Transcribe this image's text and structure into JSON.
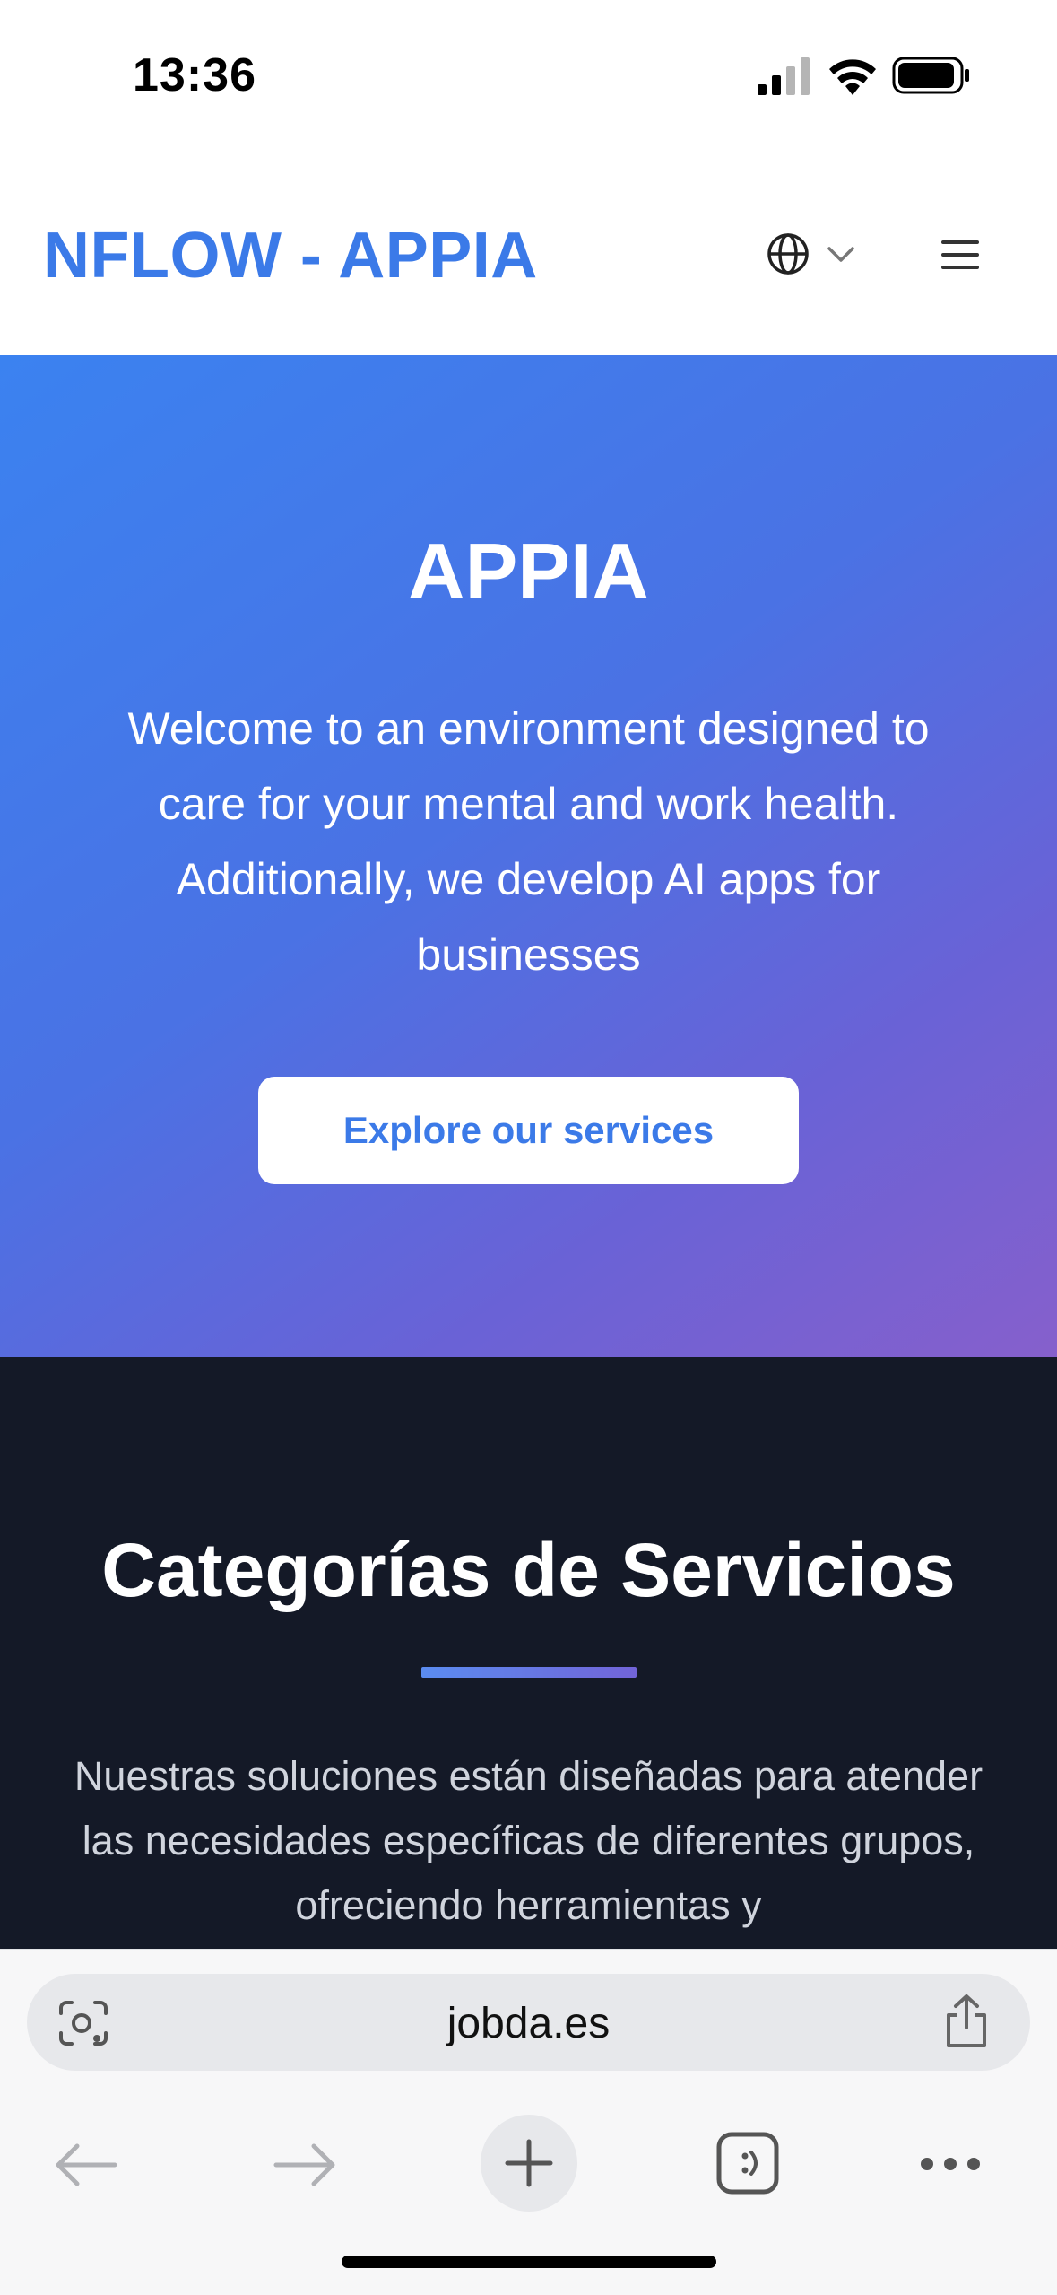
{
  "status_bar": {
    "time": "13:36",
    "icons": [
      "cellular-signal-icon",
      "wifi-icon",
      "battery-icon"
    ]
  },
  "header": {
    "brand": "NFLOW - APPIA",
    "icons": [
      "globe-icon",
      "chevron-down-icon",
      "hamburger-menu-icon"
    ]
  },
  "hero": {
    "title": "APPIA",
    "text": "Welcome to an environment designed to care for your mental and work health. Additionally, we develop AI apps for businesses",
    "cta_label": "Explore our services",
    "gradient_start": "#3b82f0",
    "gradient_end": "#8660cc"
  },
  "services": {
    "title": "Categorías de Servicios",
    "text": "Nuestras soluciones están diseñadas para atender las necesidades específicas de diferentes grupos, ofreciendo herramientas y",
    "background": "#141927"
  },
  "browser": {
    "url": "jobda.es",
    "icons": [
      "visual-search-icon",
      "share-icon",
      "back-arrow-icon",
      "forward-arrow-icon",
      "new-tab-plus-icon",
      "tabs-switcher-icon",
      "more-options-icon"
    ]
  },
  "colors": {
    "brand": "#3b7ae8",
    "white": "#ffffff"
  }
}
